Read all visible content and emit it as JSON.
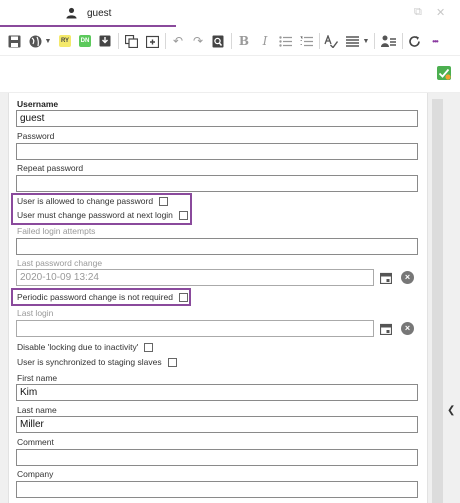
{
  "tab": {
    "label": "guest",
    "icon": "user-icon"
  },
  "window": {
    "restore": "⧉",
    "close": "✕"
  },
  "toolbar": {
    "badges": {
      "ry": "RY",
      "dn": "DN"
    },
    "bold": "B",
    "italic": "I",
    "more": "•••"
  },
  "colors": {
    "accent": "#8a4a9c",
    "ok": "#4caf50",
    "ry_bg": "#f4e96b",
    "dn_bg": "#5cc95c"
  },
  "form": {
    "username_label": "Username",
    "username_value": "guest",
    "password_label": "Password",
    "password_value": "",
    "repeat_password_label": "Repeat password",
    "repeat_password_value": "",
    "allow_change_label": "User is allowed to change password",
    "must_change_label": "User must change password at next login",
    "failed_attempts_label": "Failed login attempts",
    "failed_attempts_value": "",
    "last_pw_change_label": "Last password change",
    "last_pw_change_value": "2020-10-09 13:24",
    "periodic_label": "Periodic password change is not required",
    "last_login_label": "Last login",
    "last_login_value": "",
    "disable_locking_label": "Disable 'locking due to inactivity'",
    "sync_label": "User is synchronized to staging slaves",
    "first_name_label": "First name",
    "first_name_value": "Kim",
    "last_name_label": "Last name",
    "last_name_value": "Miller",
    "comment_label": "Comment",
    "comment_value": "",
    "company_label": "Company",
    "company_value": ""
  }
}
